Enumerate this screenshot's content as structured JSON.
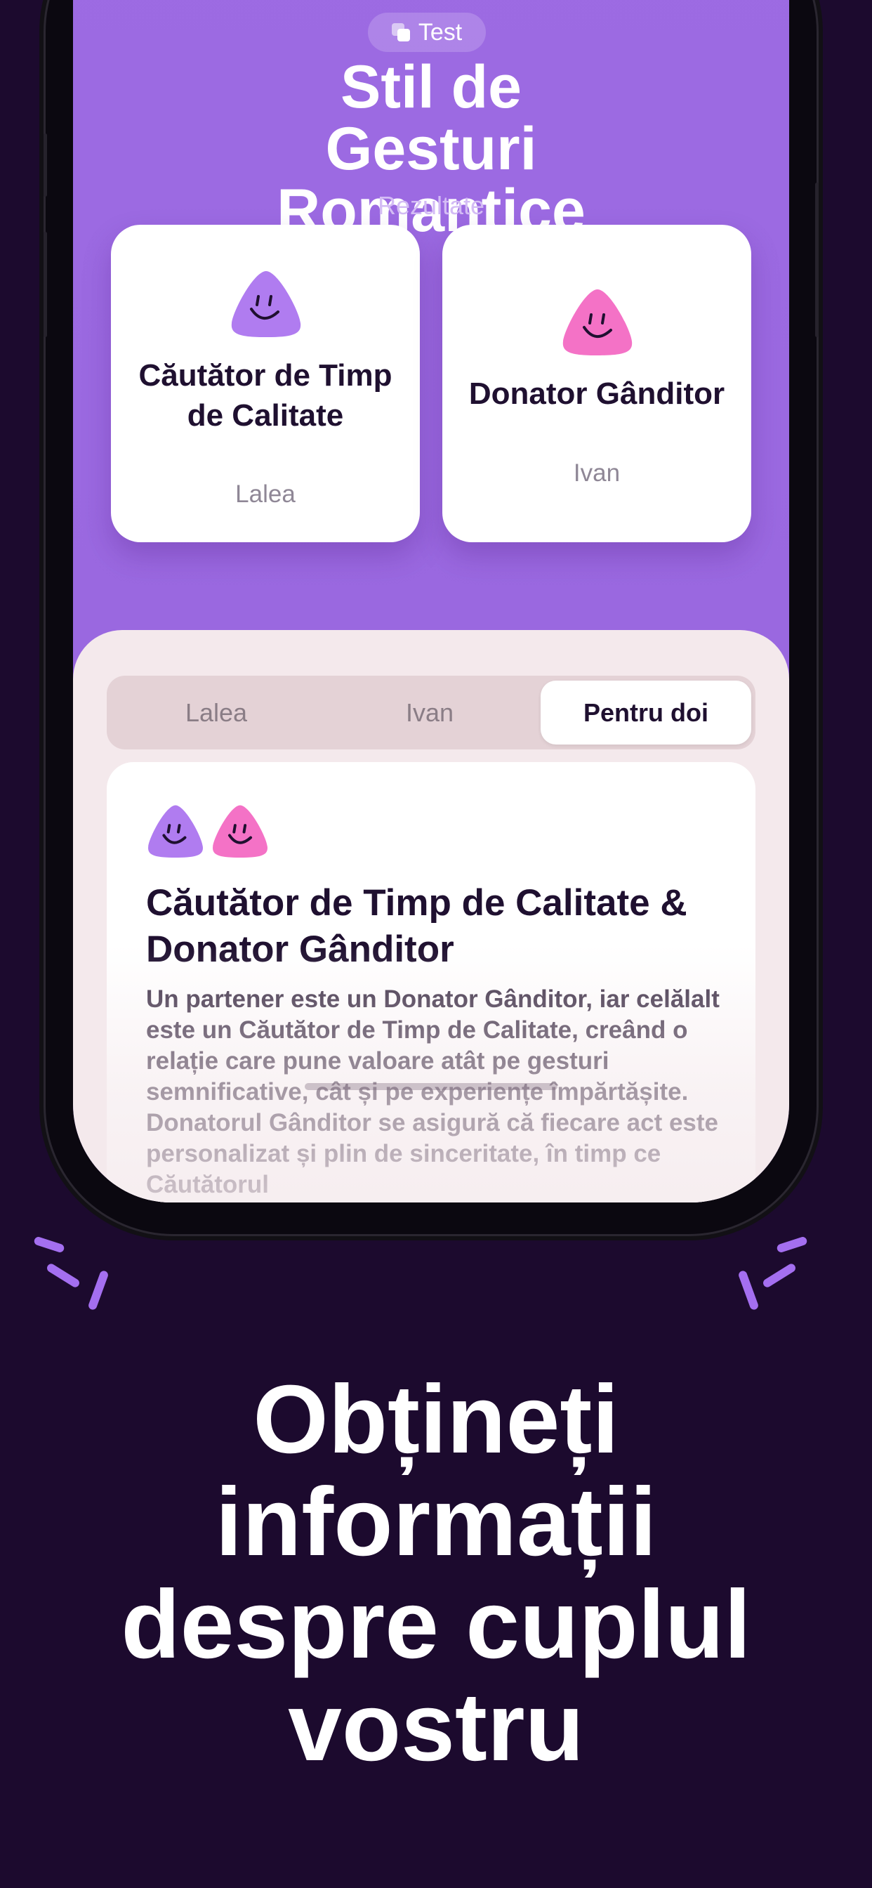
{
  "header": {
    "badge_label": "Test",
    "title": "Stil de Gesturi Romantice",
    "subtitle": "Rezultate"
  },
  "results": [
    {
      "name": "Căutător de Timp de Calitate",
      "person": "Lalea",
      "color": "#b07cf0"
    },
    {
      "name": "Donator Gânditor",
      "person": "Ivan",
      "color": "#f472c6"
    }
  ],
  "tabs": [
    {
      "label": "Lalea",
      "active": false
    },
    {
      "label": "Ivan",
      "active": false
    },
    {
      "label": "Pentru doi",
      "active": true
    }
  ],
  "detail": {
    "title": "Căutător de Timp de Calitate & Donator Gânditor",
    "body": "Un partener este un Donator Gânditor, iar celălalt este un Căutător de Timp de Calitate, creând o relație care pune valoare atât pe gesturi semnificative, cât și pe experiențe împărtășite. Donatorul Gânditor se asigură că fiecare act este personalizat și plin de sinceritate, în timp ce Căutătorul"
  },
  "headline": "Obțineți informații despre cuplul vostru",
  "colors": {
    "background": "#1c0a2e",
    "screen_purple": "#9d6be3",
    "sheet": "#f4e9ec",
    "accent_purple": "#b07cf0",
    "accent_pink": "#f472c6"
  }
}
